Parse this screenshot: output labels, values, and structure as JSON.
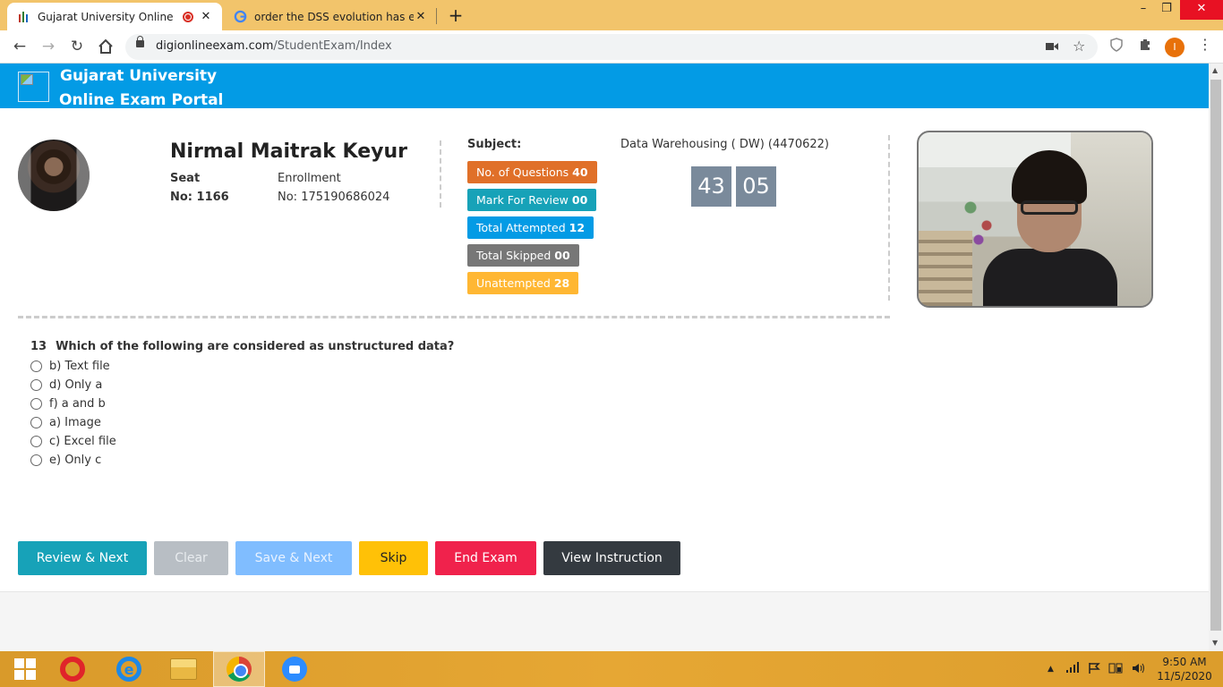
{
  "browser": {
    "tabs": [
      {
        "title": "Gujarat University Online Exa",
        "active": true
      },
      {
        "title": "order the DSS evolution has evolv",
        "active": false
      }
    ],
    "new_tab_icon": "+",
    "window": {
      "min": "–",
      "max": "❐",
      "close": "✕"
    },
    "url": {
      "domain": "digionlineexam.com",
      "path": "/StudentExam/Index"
    },
    "profile_initial": "I"
  },
  "portal": {
    "title_line1": "Gujarat University",
    "title_line2": "Online Exam Portal"
  },
  "student": {
    "name": "Nirmal Maitrak Keyur",
    "seat_label": "Seat",
    "seat_value": "No: 1166",
    "enrollment_label": "Enrollment",
    "enrollment_value": "No: 175190686024"
  },
  "exam": {
    "subject_label": "Subject:",
    "subject_value": "Data Warehousing ( DW) (4470622)",
    "badges": [
      {
        "label": "No. of Questions",
        "value": "40",
        "color": "#e07029"
      },
      {
        "label": "Mark For Review",
        "value": "00",
        "color": "#17a2b8"
      },
      {
        "label": "Total Attempted",
        "value": "12",
        "color": "#039be5"
      },
      {
        "label": "Total Skipped",
        "value": "00",
        "color": "#777777"
      },
      {
        "label": "Unattempted",
        "value": "28",
        "color": "#ffb733"
      }
    ],
    "timer_minutes": "43",
    "timer_seconds": "05"
  },
  "question": {
    "number": "13",
    "text": "Which of the following are considered as unstructured data?",
    "options": [
      "b) Text file",
      "d) Only a",
      "f) a and b",
      "a) Image",
      "c) Excel file",
      "e) Only c"
    ]
  },
  "buttons": [
    {
      "label": "Review & Next",
      "color": "#17a2b8",
      "text_color": "#ffffff"
    },
    {
      "label": "Clear",
      "color": "#b8bec4",
      "text_color": "#e8ecef"
    },
    {
      "label": "Save & Next",
      "color": "#80bdff",
      "text_color": "#e8f2ff"
    },
    {
      "label": "Skip",
      "color": "#ffc107",
      "text_color": "#222222"
    },
    {
      "label": "End Exam",
      "color": "#f0224c",
      "text_color": "#ffffff"
    },
    {
      "label": "View Instruction",
      "color": "#343a40",
      "text_color": "#ffffff"
    }
  ],
  "taskbar": {
    "time": "9:50 AM",
    "date": "11/5/2020"
  }
}
